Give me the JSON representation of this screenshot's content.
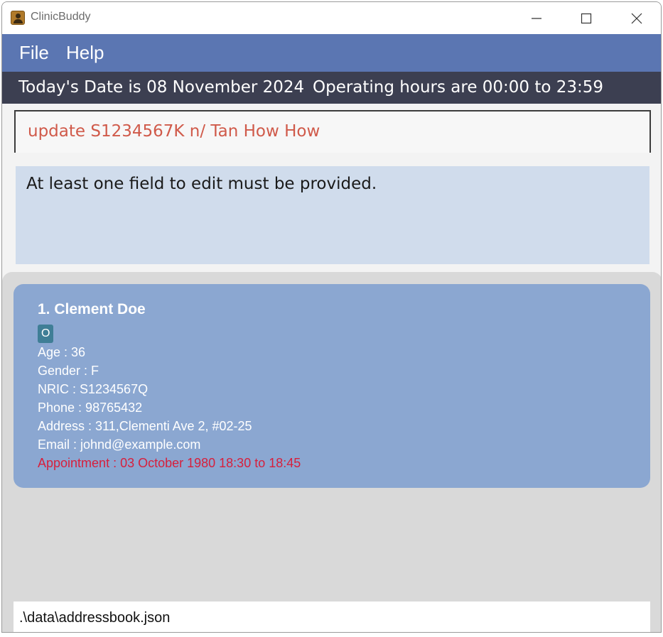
{
  "window": {
    "title": "ClinicBuddy",
    "controls": [
      "minimize-icon",
      "maximize-icon",
      "close-icon"
    ]
  },
  "menu": {
    "file": "File",
    "help": "Help"
  },
  "status": {
    "date": "Today's Date is 08 November 2024",
    "hours": "Operating hours are 00:00 to 23:59"
  },
  "command": {
    "value": "update S1234567K n/ Tan How How",
    "color": "#d05a4a"
  },
  "result": {
    "message": "At least one field to edit must be provided."
  },
  "patients": [
    {
      "name": "1. Clement Doe",
      "tag": "O",
      "age": "Age : 36",
      "gender": "Gender : F",
      "nric": "NRIC : S1234567Q",
      "phone": "Phone : 98765432",
      "address": "Address : 311,Clementi Ave 2, #02-25",
      "email": "Email : johnd@example.com",
      "appointment": "Appointment : 03 October 1980 18:30 to 18:45"
    }
  ],
  "footer": {
    "path": ".\\data\\addressbook.json"
  },
  "colors": {
    "menubar": "#5b76b2",
    "statusbar": "#3c3f51",
    "card": "#8ba7d1",
    "appointment": "#d71f3c",
    "tag": "#3f7e96"
  }
}
